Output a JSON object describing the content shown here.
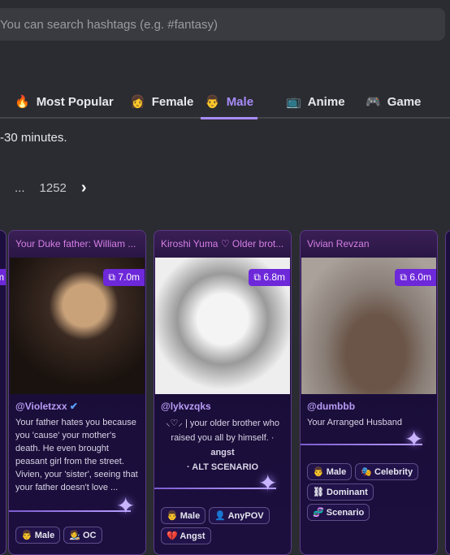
{
  "search": {
    "placeholder": "You can search hashtags (e.g. #fantasy)"
  },
  "tabs": [
    {
      "icon": "🔥",
      "label": "Most Popular"
    },
    {
      "icon": "👩",
      "label": "Female"
    },
    {
      "icon": "👨",
      "label": "Male",
      "active": true
    },
    {
      "icon": "📺",
      "label": "Anime"
    },
    {
      "icon": "🎮",
      "label": "Game"
    }
  ],
  "note": "-30 minutes.",
  "pager": {
    "ellipsis": "...",
    "last": "1252",
    "next": "›"
  },
  "left_partial_badge": "m",
  "cards": [
    {
      "title": "Your Duke father: William ...",
      "count": "7.0m",
      "author": "@Violetzxx",
      "verified": true,
      "desc": "Your father hates you because you 'cause' your mother's death. He even brought peasant girl from the street. Vivien, your 'sister', seeing that your father doesn't love ...",
      "tags": [
        {
          "icon": "👨",
          "label": "Male"
        },
        {
          "icon": "🧑‍🎨",
          "label": "OC"
        }
      ]
    },
    {
      "title": "Kiroshi Yuma ♡ Older brot...",
      "count": "6.8m",
      "author": "@lykvzqks",
      "desc": "⸜♡⸝ | your older brother who raised you all by himself. · ",
      "desc_bold": "angst",
      "desc_bold2": "· ALT SCENARIO",
      "tags": [
        {
          "icon": "👨",
          "label": "Male"
        },
        {
          "icon": "👤",
          "label": "AnyPOV"
        },
        {
          "icon": "💔",
          "label": "Angst"
        }
      ]
    },
    {
      "title": "Vivian Revzan",
      "count": "6.0m",
      "author": "@dumbbb",
      "desc": "Your Arranged Husband",
      "tags": [
        {
          "icon": "👨",
          "label": "Male"
        },
        {
          "icon": "🎭",
          "label": "Celebrity"
        },
        {
          "icon": "⛓",
          "label": "Dominant"
        },
        {
          "icon": "🧬",
          "label": "Scenario"
        }
      ]
    }
  ]
}
